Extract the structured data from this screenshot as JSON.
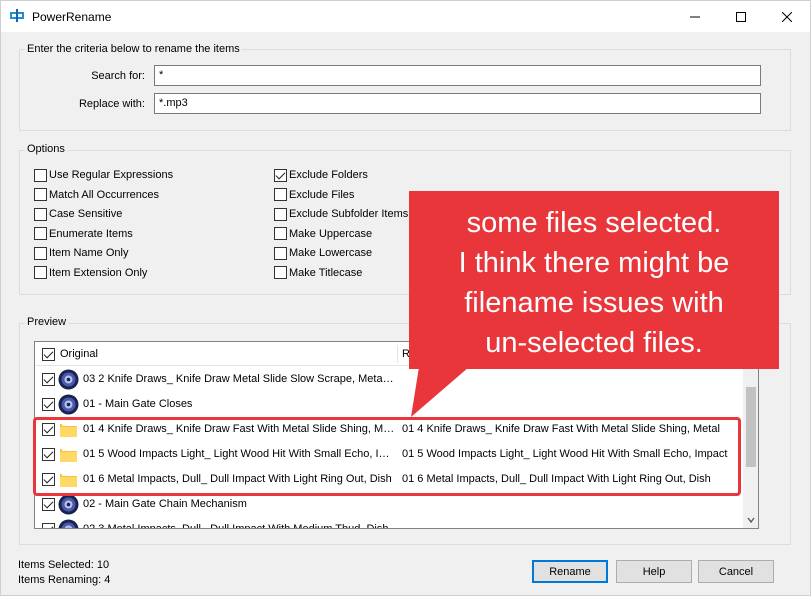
{
  "window": {
    "title": "PowerRename"
  },
  "criteria": {
    "group_label": "Enter the criteria below to rename the items",
    "search_label": "Search for:",
    "search_value": "*",
    "replace_label": "Replace with:",
    "replace_value": "*.mp3"
  },
  "options": {
    "group_label": "Options",
    "left": [
      {
        "label": "Use Regular Expressions",
        "checked": false
      },
      {
        "label": "Match All Occurrences",
        "checked": false
      },
      {
        "label": "Case Sensitive",
        "checked": false
      },
      {
        "label": "Enumerate Items",
        "checked": false
      },
      {
        "label": "Item Name Only",
        "checked": false
      },
      {
        "label": "Item Extension Only",
        "checked": false
      }
    ],
    "right": [
      {
        "label": "Exclude Folders",
        "checked": true
      },
      {
        "label": "Exclude Files",
        "checked": false
      },
      {
        "label": "Exclude Subfolder Items",
        "checked": false
      },
      {
        "label": "Make Uppercase",
        "checked": false
      },
      {
        "label": "Make Lowercase",
        "checked": false
      },
      {
        "label": "Make Titlecase",
        "checked": false
      }
    ]
  },
  "preview": {
    "group_label": "Preview",
    "col_original": "Original",
    "col_renamed": "R",
    "rows": [
      {
        "original": "03 2 Knife Draws_ Knife Draw Metal Slide Slow Scrape, Metal S...",
        "renamed": "",
        "icon": "audio-disc-icon",
        "checked": true
      },
      {
        "original": "01 - Main Gate Closes",
        "renamed": "",
        "icon": "audio-disc-icon",
        "checked": true
      },
      {
        "original": "01 4 Knife Draws_ Knife Draw Fast With Metal Slide Shing, Metal",
        "renamed": "01 4 Knife Draws_ Knife Draw Fast With Metal Slide Shing, Metal",
        "icon": "folder-icon",
        "checked": true
      },
      {
        "original": "01 5 Wood Impacts Light_ Light Wood Hit With Small Echo, Im...",
        "renamed": "01 5 Wood Impacts Light_ Light Wood Hit With Small Echo, Impact",
        "icon": "folder-icon",
        "checked": true
      },
      {
        "original": "01 6 Metal Impacts, Dull_ Dull Impact With Light Ring Out, Dish",
        "renamed": "01 6 Metal Impacts, Dull_ Dull Impact With Light Ring Out, Dish",
        "icon": "folder-icon",
        "checked": true
      },
      {
        "original": "02 - Main Gate Chain Mechanism",
        "renamed": "",
        "icon": "audio-disc-icon",
        "checked": true
      },
      {
        "original": "02 3 Metal Impacts, Dull_ Dull Impact With Medium Thud, Dish",
        "renamed": "",
        "icon": "audio-disc-icon",
        "checked": true
      }
    ]
  },
  "status": {
    "items_selected": "Items Selected: 10",
    "items_renaming": "Items Renaming: 4"
  },
  "buttons": {
    "rename": "Rename",
    "help": "Help",
    "cancel": "Cancel"
  },
  "annotation": {
    "text": "some files selected.\nI think there might be\nfilename issues with\nun-selected files.",
    "color": "#e8363b"
  }
}
